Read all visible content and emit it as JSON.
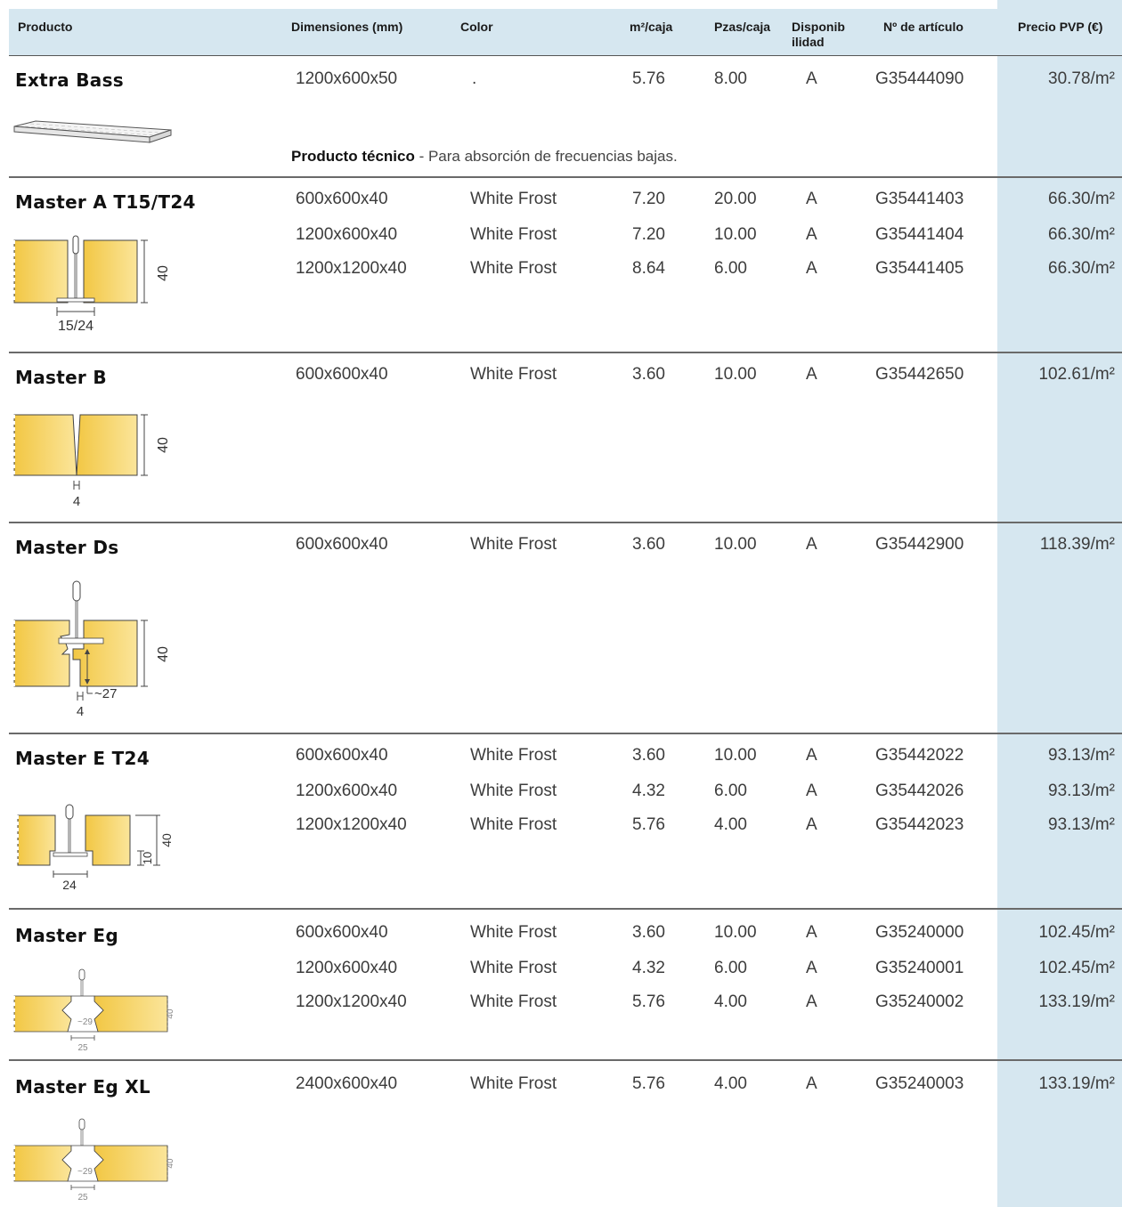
{
  "headers": {
    "producto": "Producto",
    "dimensiones": "Dimensiones (mm)",
    "color": "Color",
    "m2caja": "m²/caja",
    "pzas": "Pzas/caja",
    "disp1": "Disponib",
    "disp2": "ilidad",
    "articulo": "Nº de artículo",
    "precio": "Precio PVP (€)"
  },
  "colors": {
    "header_bg": "#d6e7f0",
    "price_col_bg": "#d6e7f0",
    "tile_yellow": "#f5d061"
  },
  "products": [
    {
      "name": "Extra Bass",
      "note_bold": "Producto técnico",
      "note_text": " - Para absorción de frecuencias bajas.",
      "rows": [
        {
          "dim": "1200x600x50",
          "color": ".",
          "m2": "5.76",
          "pz": "8.00",
          "disp": "A",
          "art": "G35444090",
          "price": "30.78/m²"
        }
      ]
    },
    {
      "name": "Master A T15/T24",
      "fig_labels": {
        "height": "40",
        "width": "15/24"
      },
      "rows": [
        {
          "dim": "600x600x40",
          "color": "White Frost",
          "m2": "7.20",
          "pz": "20.00",
          "disp": "A",
          "art": "G35441403",
          "price": "66.30/m²"
        },
        {
          "dim": "1200x600x40",
          "color": "White Frost",
          "m2": "7.20",
          "pz": "10.00",
          "disp": "A",
          "art": "G35441404",
          "price": "66.30/m²"
        },
        {
          "dim": "1200x1200x40",
          "color": "White Frost",
          "m2": "8.64",
          "pz": "6.00",
          "disp": "A",
          "art": "G35441405",
          "price": "66.30/m²"
        }
      ]
    },
    {
      "name": "Master B",
      "fig_labels": {
        "height": "40",
        "width": "4"
      },
      "rows": [
        {
          "dim": "600x600x40",
          "color": "White Frost",
          "m2": "3.60",
          "pz": "10.00",
          "disp": "A",
          "art": "G35442650",
          "price": "102.61/m²"
        }
      ]
    },
    {
      "name": "Master Ds",
      "fig_labels": {
        "height": "40",
        "width": "4",
        "depth": "~27"
      },
      "rows": [
        {
          "dim": "600x600x40",
          "color": "White Frost",
          "m2": "3.60",
          "pz": "10.00",
          "disp": "A",
          "art": "G35442900",
          "price": "118.39/m²"
        }
      ]
    },
    {
      "name": "Master E T24",
      "fig_labels": {
        "height": "40",
        "inner": "10",
        "width": "24"
      },
      "rows": [
        {
          "dim": "600x600x40",
          "color": "White Frost",
          "m2": "3.60",
          "pz": "10.00",
          "disp": "A",
          "art": "G35442022",
          "price": "93.13/m²"
        },
        {
          "dim": "1200x600x40",
          "color": "White Frost",
          "m2": "4.32",
          "pz": "6.00",
          "disp": "A",
          "art": "G35442026",
          "price": "93.13/m²"
        },
        {
          "dim": "1200x1200x40",
          "color": "White Frost",
          "m2": "5.76",
          "pz": "4.00",
          "disp": "A",
          "art": "G35442023",
          "price": "93.13/m²"
        }
      ]
    },
    {
      "name": "Master Eg",
      "fig_labels": {
        "height": "40",
        "depth": "~29",
        "width": "25"
      },
      "rows": [
        {
          "dim": "600x600x40",
          "color": "White Frost",
          "m2": "3.60",
          "pz": "10.00",
          "disp": "A",
          "art": "G35240000",
          "price": "102.45/m²"
        },
        {
          "dim": "1200x600x40",
          "color": "White Frost",
          "m2": "4.32",
          "pz": "6.00",
          "disp": "A",
          "art": "G35240001",
          "price": "102.45/m²"
        },
        {
          "dim": "1200x1200x40",
          "color": "White Frost",
          "m2": "5.76",
          "pz": "4.00",
          "disp": "A",
          "art": "G35240002",
          "price": "133.19/m²"
        }
      ]
    },
    {
      "name": "Master Eg XL",
      "fig_labels": {
        "height": "40",
        "depth": "~29",
        "width": "25"
      },
      "rows": [
        {
          "dim": "2400x600x40",
          "color": "White Frost",
          "m2": "5.76",
          "pz": "4.00",
          "disp": "A",
          "art": "G35240003",
          "price": "133.19/m²"
        }
      ]
    }
  ]
}
